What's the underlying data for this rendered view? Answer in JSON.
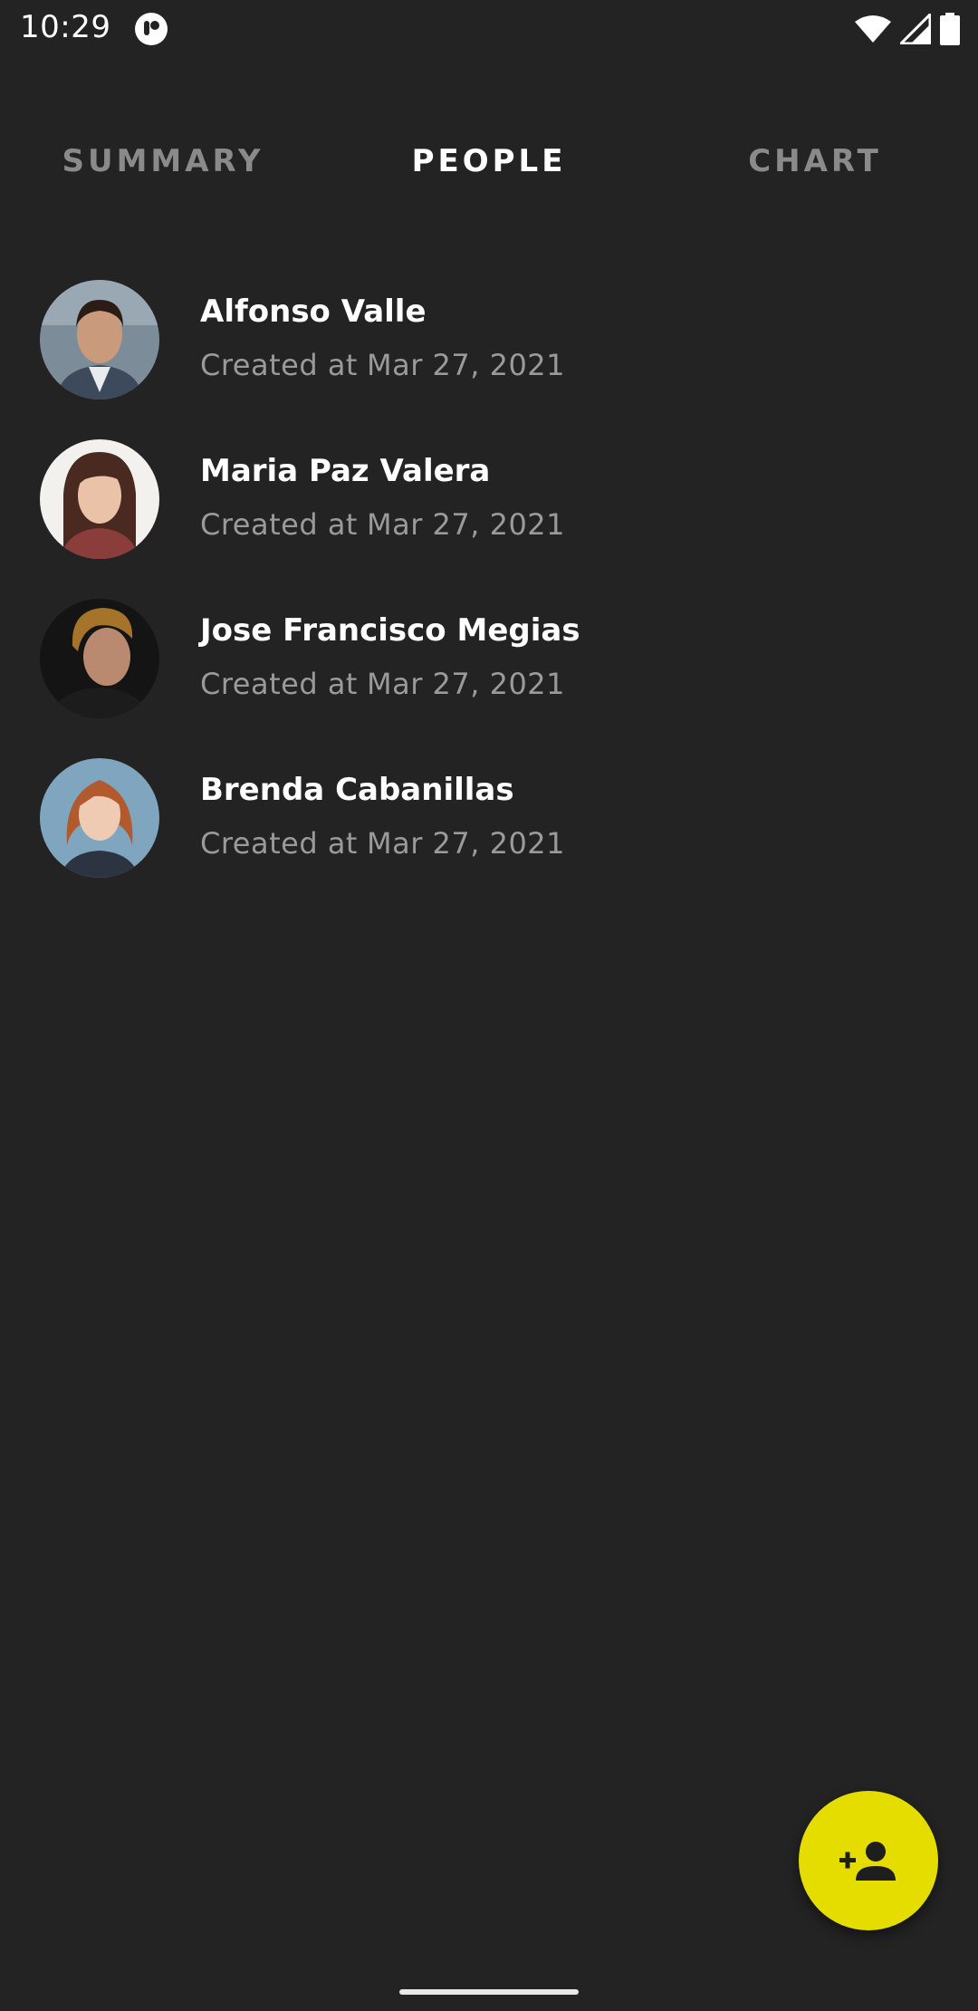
{
  "status_bar": {
    "time": "10:29",
    "icons": [
      "app-notification-icon",
      "wifi-icon",
      "signal-icon",
      "battery-icon"
    ]
  },
  "tabs": [
    {
      "label": "SUMMARY",
      "active": false
    },
    {
      "label": "PEOPLE",
      "active": true
    },
    {
      "label": "CHART",
      "active": false
    }
  ],
  "people": [
    {
      "name": "Alfonso Valle",
      "created_prefix": "Created at",
      "created_date": "Mar 27, 2021"
    },
    {
      "name": "Maria Paz Valera",
      "created_prefix": "Created at",
      "created_date": "Mar 27, 2021"
    },
    {
      "name": "Jose Francisco Megias",
      "created_prefix": "Created at",
      "created_date": "Mar 27, 2021"
    },
    {
      "name": "Brenda Cabanillas",
      "created_prefix": "Created at",
      "created_date": "Mar 27, 2021"
    }
  ],
  "fab": {
    "icon": "add-person-icon"
  },
  "colors": {
    "background": "#232323",
    "accent": "#e6dd00",
    "tab_inactive": "#8a8a8a",
    "secondary_text": "#9a9a9a"
  }
}
